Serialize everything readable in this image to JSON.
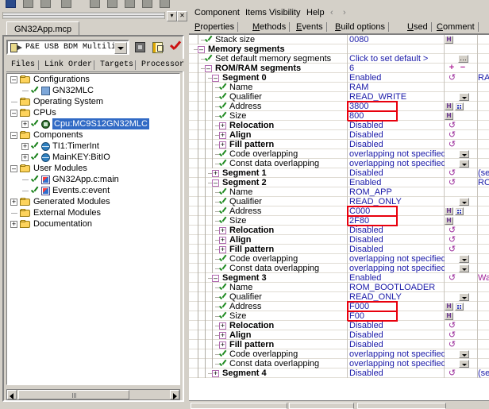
{
  "window": {
    "left_panel": {
      "tab_label": "GN32App.mcp",
      "toolbar": {
        "connection_value": "P&E USB BDM Multilink",
        "icons": [
          "target-chip-icon",
          "bean-settings-icon",
          "red-check-icon"
        ]
      },
      "view_tabs": [
        {
          "label": "Files",
          "selected": false
        },
        {
          "label": "Link Order",
          "selected": false
        },
        {
          "label": "Targets",
          "selected": false
        },
        {
          "label": "Processor Exper",
          "selected": true
        }
      ],
      "tree": [
        {
          "label": "Configurations",
          "indent": 0,
          "expander": "minus",
          "icon": "folder-icon",
          "check": false,
          "selected": false
        },
        {
          "label": "GN32MLC",
          "indent": 1,
          "expander": "none",
          "icon": "config-icon",
          "check": true,
          "selected": false
        },
        {
          "label": "Operating System",
          "indent": 0,
          "expander": "none",
          "icon": "folder-icon",
          "check": false,
          "selected": false
        },
        {
          "label": "CPUs",
          "indent": 0,
          "expander": "minus",
          "icon": "folder-icon",
          "check": false,
          "selected": false
        },
        {
          "label": "Cpu:MC9S12GN32MLC",
          "indent": 1,
          "expander": "plus",
          "icon": "cpu-icon",
          "check": true,
          "selected": true
        },
        {
          "label": "Components",
          "indent": 0,
          "expander": "minus",
          "icon": "folder-icon",
          "check": false,
          "selected": false
        },
        {
          "label": "TI1:TimerInt",
          "indent": 1,
          "expander": "plus",
          "icon": "bean-icon",
          "check": true,
          "selected": false
        },
        {
          "label": "MainKEY:BitIO",
          "indent": 1,
          "expander": "plus",
          "icon": "bean-icon",
          "check": true,
          "selected": false
        },
        {
          "label": "User Modules",
          "indent": 0,
          "expander": "minus",
          "icon": "folder-icon",
          "check": false,
          "selected": false
        },
        {
          "label": "GN32App.c:main",
          "indent": 1,
          "expander": "none",
          "icon": "source-icon",
          "check": true,
          "selected": false
        },
        {
          "label": "Events.c:event",
          "indent": 1,
          "expander": "none",
          "icon": "source-icon",
          "check": true,
          "selected": false
        },
        {
          "label": "Generated Modules",
          "indent": 0,
          "expander": "plus",
          "icon": "folder-icon",
          "check": false,
          "selected": false
        },
        {
          "label": "External Modules",
          "indent": 0,
          "expander": "none",
          "icon": "folder-icon",
          "check": false,
          "selected": false
        },
        {
          "label": "Documentation",
          "indent": 0,
          "expander": "plus",
          "icon": "folder-icon",
          "check": false,
          "selected": false
        }
      ]
    },
    "right_panel": {
      "menu": [
        {
          "label": "Component"
        },
        {
          "label": "Items Visibility"
        },
        {
          "label": "Help"
        }
      ],
      "nav_prev": "‹",
      "nav_next": "›",
      "tabs": [
        {
          "label": "Properties",
          "accel": "P",
          "selected": false
        },
        {
          "label": "Methods",
          "accel": "M",
          "selected": false
        },
        {
          "label": "Events",
          "accel": "E",
          "selected": false
        },
        {
          "label": "Build options",
          "accel": "B",
          "selected": true
        },
        {
          "label": "Used",
          "accel": "U",
          "selected": false
        },
        {
          "label": "Comment",
          "accel": "C",
          "selected": false
        }
      ],
      "rows": [
        {
          "name": "Stack size",
          "value": "0080",
          "indent": 2,
          "marker": "tick",
          "bold": false,
          "buttons": [
            "H"
          ],
          "note": ""
        },
        {
          "name": "Memory segments",
          "value": "",
          "indent": 1,
          "marker": "minus",
          "bold": true,
          "buttons": [],
          "note": ""
        },
        {
          "name": "Set default memory segments",
          "value": "Click to set default >",
          "indent": 2,
          "marker": "tick",
          "bold": false,
          "buttons": [
            "ellipsis"
          ],
          "note": ""
        },
        {
          "name": "ROM/RAM segments",
          "value": "6",
          "indent": 2,
          "marker": "minus",
          "bold": true,
          "buttons": [
            "plus",
            "minus"
          ],
          "note": ""
        },
        {
          "name": "Segment 0",
          "value": "Enabled",
          "indent": 3,
          "marker": "minus",
          "bold": true,
          "buttons": [
            "undo"
          ],
          "note": "RAM"
        },
        {
          "name": "Name",
          "value": "RAM",
          "indent": 4,
          "marker": "tick",
          "bold": false,
          "buttons": [],
          "note": ""
        },
        {
          "name": "Qualifier",
          "value": "READ_WRITE",
          "indent": 4,
          "marker": "tick",
          "bold": false,
          "buttons": [
            "dropdown"
          ],
          "note": ""
        },
        {
          "name": "Address",
          "value": "3800",
          "indent": 4,
          "marker": "tick",
          "bold": false,
          "buttons": [
            "H",
            "grid"
          ],
          "note": "",
          "highlight": true
        },
        {
          "name": "Size",
          "value": "800",
          "indent": 4,
          "marker": "tick",
          "bold": false,
          "buttons": [
            "H"
          ],
          "note": "",
          "highlight": true
        },
        {
          "name": "Relocation",
          "value": "Disabled",
          "indent": 4,
          "marker": "plus",
          "bold": true,
          "buttons": [
            "undo"
          ],
          "note": ""
        },
        {
          "name": "Align",
          "value": "Disabled",
          "indent": 4,
          "marker": "plus",
          "bold": true,
          "buttons": [
            "undo"
          ],
          "note": ""
        },
        {
          "name": "Fill pattern",
          "value": "Disabled",
          "indent": 4,
          "marker": "plus",
          "bold": true,
          "buttons": [
            "undo"
          ],
          "note": ""
        },
        {
          "name": "Code overlapping",
          "value": "overlapping not specified",
          "indent": 4,
          "marker": "tick",
          "bold": false,
          "buttons": [
            "dropdown"
          ],
          "note": ""
        },
        {
          "name": "Const data overlapping",
          "value": "overlapping not specified",
          "indent": 4,
          "marker": "tick",
          "bold": false,
          "buttons": [
            "dropdown"
          ],
          "note": ""
        },
        {
          "name": "Segment 1",
          "value": "Disabled",
          "indent": 3,
          "marker": "plus",
          "bold": true,
          "buttons": [
            "undo"
          ],
          "note": "(segment"
        },
        {
          "name": "Segment 2",
          "value": "Enabled",
          "indent": 3,
          "marker": "minus",
          "bold": true,
          "buttons": [
            "undo"
          ],
          "note": "ROM_AP"
        },
        {
          "name": "Name",
          "value": "ROM_APP",
          "indent": 4,
          "marker": "tick",
          "bold": false,
          "buttons": [],
          "note": ""
        },
        {
          "name": "Qualifier",
          "value": "READ_ONLY",
          "indent": 4,
          "marker": "tick",
          "bold": false,
          "buttons": [
            "dropdown"
          ],
          "note": ""
        },
        {
          "name": "Address",
          "value": "C000",
          "indent": 4,
          "marker": "tick",
          "bold": false,
          "buttons": [
            "H",
            "grid"
          ],
          "note": "",
          "highlight": true
        },
        {
          "name": "Size",
          "value": "2F80",
          "indent": 4,
          "marker": "tick",
          "bold": false,
          "buttons": [
            "H"
          ],
          "note": "",
          "highlight": true
        },
        {
          "name": "Relocation",
          "value": "Disabled",
          "indent": 4,
          "marker": "plus",
          "bold": true,
          "buttons": [
            "undo"
          ],
          "note": ""
        },
        {
          "name": "Align",
          "value": "Disabled",
          "indent": 4,
          "marker": "plus",
          "bold": true,
          "buttons": [
            "undo"
          ],
          "note": ""
        },
        {
          "name": "Fill pattern",
          "value": "Disabled",
          "indent": 4,
          "marker": "plus",
          "bold": true,
          "buttons": [
            "undo"
          ],
          "note": ""
        },
        {
          "name": "Code overlapping",
          "value": "overlapping not specified",
          "indent": 4,
          "marker": "tick",
          "bold": false,
          "buttons": [
            "dropdown"
          ],
          "note": ""
        },
        {
          "name": "Const data overlapping",
          "value": "overlapping not specified",
          "indent": 4,
          "marker": "tick",
          "bold": false,
          "buttons": [
            "dropdown"
          ],
          "note": ""
        },
        {
          "name": "Segment 3",
          "value": "Enabled",
          "indent": 3,
          "marker": "minus",
          "bold": true,
          "buttons": [
            "undo"
          ],
          "note": "Warning",
          "note_warn": true
        },
        {
          "name": "Name",
          "value": "ROM_BOOTLOADER",
          "indent": 4,
          "marker": "tick",
          "bold": false,
          "buttons": [],
          "note": ""
        },
        {
          "name": "Qualifier",
          "value": "READ_ONLY",
          "indent": 4,
          "marker": "tick",
          "bold": false,
          "buttons": [
            "dropdown"
          ],
          "note": ""
        },
        {
          "name": "Address",
          "value": "F000",
          "indent": 4,
          "marker": "tick",
          "bold": false,
          "buttons": [
            "H",
            "grid"
          ],
          "note": "",
          "highlight": true
        },
        {
          "name": "Size",
          "value": "F00",
          "indent": 4,
          "marker": "tick",
          "bold": false,
          "buttons": [
            "H"
          ],
          "note": "",
          "highlight": true
        },
        {
          "name": "Relocation",
          "value": "Disabled",
          "indent": 4,
          "marker": "plus",
          "bold": true,
          "buttons": [
            "undo"
          ],
          "note": ""
        },
        {
          "name": "Align",
          "value": "Disabled",
          "indent": 4,
          "marker": "plus",
          "bold": true,
          "buttons": [
            "undo"
          ],
          "note": ""
        },
        {
          "name": "Fill pattern",
          "value": "Disabled",
          "indent": 4,
          "marker": "plus",
          "bold": true,
          "buttons": [
            "undo"
          ],
          "note": ""
        },
        {
          "name": "Code overlapping",
          "value": "overlapping not specified",
          "indent": 4,
          "marker": "tick",
          "bold": false,
          "buttons": [
            "dropdown"
          ],
          "note": ""
        },
        {
          "name": "Const data overlapping",
          "value": "overlapping not specified",
          "indent": 4,
          "marker": "tick",
          "bold": false,
          "buttons": [
            "dropdown"
          ],
          "note": ""
        },
        {
          "name": "Segment 4",
          "value": "Disabled",
          "indent": 3,
          "marker": "plus",
          "bold": true,
          "buttons": [
            "undo"
          ],
          "note": "(segment"
        }
      ]
    }
  },
  "colors": {
    "value_text": "#1a1aa8",
    "highlight_box": "#e8000d",
    "selection": "#316ac5",
    "warning_text": "#a0229a",
    "face": "#d4d0c8"
  }
}
